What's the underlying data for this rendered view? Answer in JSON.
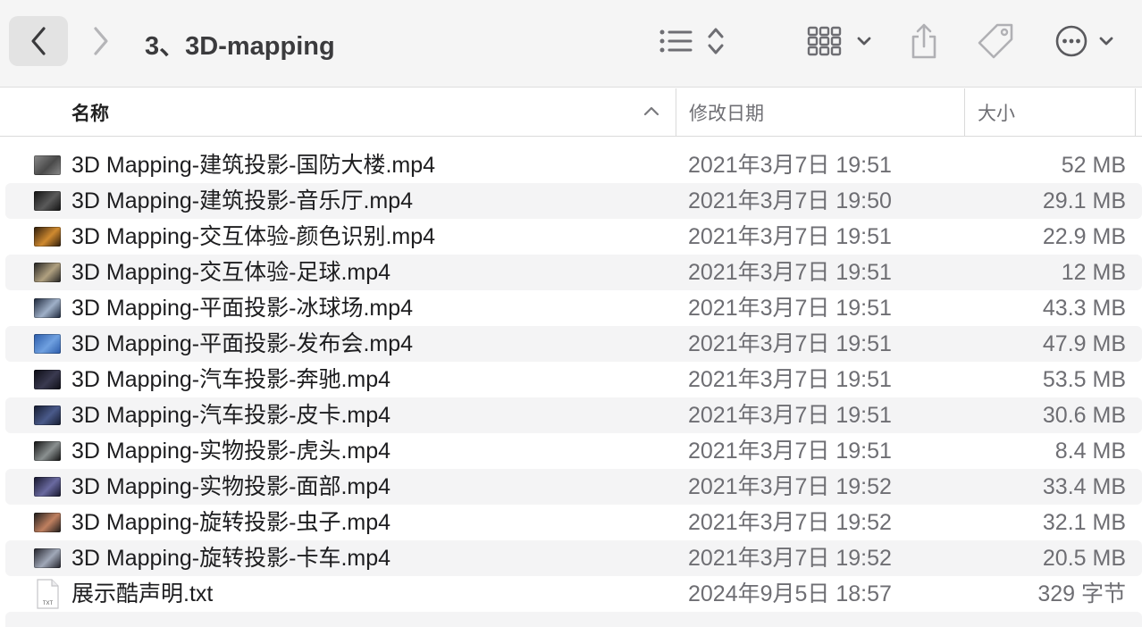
{
  "toolbar": {
    "title": "3、3D-mapping",
    "icons": [
      "chevron-left-icon",
      "chevron-right-icon",
      "list-view-icon",
      "sort-arrows-icon",
      "grid-view-icon",
      "chevron-down-icon",
      "share-icon",
      "tag-icon",
      "more-icon",
      "chevron-down-icon"
    ]
  },
  "columns": {
    "name": "名称",
    "date": "修改日期",
    "size": "大小",
    "sort_icon": "chevron-up-icon"
  },
  "files": [
    {
      "name": "3D Mapping-建筑投影-国防大楼.mp4",
      "date": "2021年3月7日 19:51",
      "size": "52 MB",
      "kind": "video",
      "thumb_colors": [
        "#8a8a8a",
        "#4a4a4a"
      ]
    },
    {
      "name": "3D Mapping-建筑投影-音乐厅.mp4",
      "date": "2021年3月7日 19:50",
      "size": "29.1 MB",
      "kind": "video",
      "thumb_colors": [
        "#111111",
        "#5a5a5a"
      ]
    },
    {
      "name": "3D Mapping-交互体验-颜色识别.mp4",
      "date": "2021年3月7日 19:51",
      "size": "22.9 MB",
      "kind": "video",
      "thumb_colors": [
        "#2a1a0a",
        "#d08a30"
      ]
    },
    {
      "name": "3D Mapping-交互体验-足球.mp4",
      "date": "2021年3月7日 19:51",
      "size": "12 MB",
      "kind": "video",
      "thumb_colors": [
        "#202020",
        "#b0a080"
      ]
    },
    {
      "name": "3D Mapping-平面投影-冰球场.mp4",
      "date": "2021年3月7日 19:51",
      "size": "43.3 MB",
      "kind": "video",
      "thumb_colors": [
        "#1a2438",
        "#9fb0c8"
      ]
    },
    {
      "name": "3D Mapping-平面投影-发布会.mp4",
      "date": "2021年3月7日 19:51",
      "size": "47.9 MB",
      "kind": "video",
      "thumb_colors": [
        "#2a5aa8",
        "#6fa0e0"
      ]
    },
    {
      "name": "3D Mapping-汽车投影-奔驰.mp4",
      "date": "2021年3月7日 19:51",
      "size": "53.5 MB",
      "kind": "video",
      "thumb_colors": [
        "#0c0c14",
        "#3a3a50"
      ]
    },
    {
      "name": "3D Mapping-汽车投影-皮卡.mp4",
      "date": "2021年3月7日 19:51",
      "size": "30.6 MB",
      "kind": "video",
      "thumb_colors": [
        "#141a2e",
        "#4a5a8a"
      ]
    },
    {
      "name": "3D Mapping-实物投影-虎头.mp4",
      "date": "2021年3月7日 19:51",
      "size": "8.4 MB",
      "kind": "video",
      "thumb_colors": [
        "#101010",
        "#8a9090"
      ]
    },
    {
      "name": "3D Mapping-实物投影-面部.mp4",
      "date": "2021年3月7日 19:52",
      "size": "33.4 MB",
      "kind": "video",
      "thumb_colors": [
        "#14142a",
        "#6a6aa0"
      ]
    },
    {
      "name": "3D Mapping-旋转投影-虫子.mp4",
      "date": "2021年3月7日 19:52",
      "size": "32.1 MB",
      "kind": "video",
      "thumb_colors": [
        "#1a1a1a",
        "#c08060"
      ]
    },
    {
      "name": "3D Mapping-旋转投影-卡车.mp4",
      "date": "2021年3月7日 19:52",
      "size": "20.5 MB",
      "kind": "video",
      "thumb_colors": [
        "#202028",
        "#a0a8b8"
      ]
    },
    {
      "name": "展示酷声明.txt",
      "date": "2024年9月5日 18:57",
      "size": "329 字节",
      "kind": "text",
      "icon_label": "TXT"
    }
  ]
}
